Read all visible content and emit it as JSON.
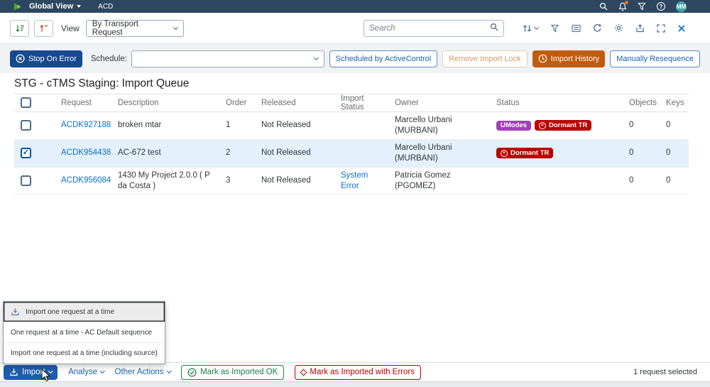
{
  "topbar": {
    "app_name": "Global View",
    "system": "ACD",
    "avatar_initials": "MM"
  },
  "toolbar": {
    "view_label": "View",
    "view_value": "By Transport Request",
    "search_placeholder": "Search"
  },
  "actionbar": {
    "stop_on_error": "Stop On Error",
    "schedule_label": "Schedule:",
    "schedule_value": "",
    "scheduled_by_activecontrol": "Scheduled by ActiveControl",
    "remove_import_lock": "Remove Import Lock",
    "import_history": "Import History",
    "manually_resequence": "Manually Resequence"
  },
  "page_title": "STG - cTMS Staging: Import Queue",
  "table": {
    "headers": {
      "request": "Request",
      "description": "Description",
      "order": "Order",
      "released": "Released",
      "import_status": "Import Status",
      "owner": "Owner",
      "status": "Status",
      "objects": "Objects",
      "keys": "Keys"
    },
    "rows": [
      {
        "checked": false,
        "request": "ACDK927188",
        "description": "broken mtar",
        "order": "1",
        "released": "Not Released",
        "import_status": "",
        "owner": "Marcello Urbani (MURBANI)",
        "badges": [
          {
            "label": "UModes",
            "color": "#a23fb5",
            "icon": false
          },
          {
            "label": "Dormant TR",
            "color": "#bb0000",
            "icon": true
          }
        ],
        "objects": "0",
        "keys": "0"
      },
      {
        "checked": true,
        "request": "ACDK954438",
        "description": "AC-672 test",
        "order": "2",
        "released": "Not Released",
        "import_status": "",
        "owner": "Marcello Urbani (MURBANI)",
        "badges": [
          {
            "label": "Dormant TR",
            "color": "#bb0000",
            "icon": true
          }
        ],
        "objects": "0",
        "keys": "0"
      },
      {
        "checked": false,
        "request": "ACDK956084",
        "description": "1430 My Project 2.0.0 ( P da Costa )",
        "order": "3",
        "released": "Not Released",
        "import_status": "System Error",
        "owner": "Patricia Gomez (PGOMEZ)",
        "badges": [],
        "objects": "0",
        "keys": "0"
      }
    ]
  },
  "import_menu": {
    "items": [
      {
        "label": "Import one request at a time",
        "icon": true,
        "focused": true
      },
      {
        "label": "One request at a time - AC Default sequence",
        "icon": false,
        "focused": false
      },
      {
        "label": "Import one request at a time (including source)",
        "icon": false,
        "focused": false
      }
    ]
  },
  "footer": {
    "import": "Import",
    "analyse": "Analyse",
    "other_actions": "Other Actions",
    "mark_imported_ok": "Mark as Imported OK",
    "mark_imported_errors": "Mark as Imported with Errors",
    "selection_status": "1 request selected"
  },
  "colors": {
    "accent_blue": "#0a6ed1",
    "shell_bar": "#2e4760",
    "stop_on_error_bg": "#16498e",
    "import_history_bg": "#c05c0e",
    "badge_purple": "#a23fb5",
    "badge_red": "#bb0000",
    "positive_green": "#1d8043",
    "negative_red": "#bb0000",
    "selected_row_bg": "#e4f0fb",
    "avatar_bg": "#3fa9a5"
  }
}
